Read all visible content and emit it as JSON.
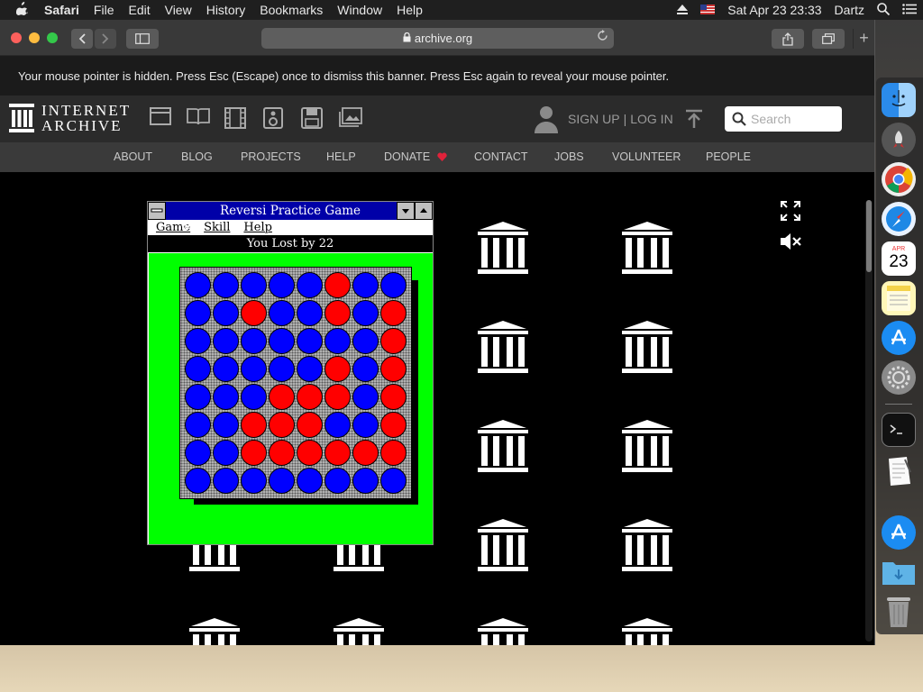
{
  "menubar": {
    "apple": "",
    "app_name": "Safari",
    "items": [
      "File",
      "Edit",
      "View",
      "History",
      "Bookmarks",
      "Window",
      "Help"
    ],
    "clock": "Sat Apr 23  23:33",
    "user": "Dartz"
  },
  "browser": {
    "url": "archive.org",
    "banner": "Your mouse pointer is hidden. Press Esc (Escape) once to dismiss this banner. Press Esc again to reveal your mouse pointer."
  },
  "ia": {
    "logo_line1": "INTERNET",
    "logo_line2": "ARCHIVE",
    "sign_up": "SIGN UP",
    "separator": "|",
    "log_in": "LOG IN",
    "search_placeholder": "Search",
    "nav": [
      "ABOUT",
      "BLOG",
      "PROJECTS",
      "HELP",
      "DONATE",
      "CONTACT",
      "JOBS",
      "VOLUNTEER",
      "PEOPLE"
    ],
    "donate_heart_color": "#e0223a",
    "media_icons": [
      "web-icon",
      "texts-icon",
      "video-icon",
      "audio-icon",
      "software-icon",
      "images-icon"
    ]
  },
  "game": {
    "title": "Reversi Practice Game",
    "menu": [
      "Game",
      "Skill",
      "Help"
    ],
    "status": "You Lost by 22",
    "colors": {
      "blue": "#0000ff",
      "red": "#ff0000",
      "felt": "#00ff00",
      "titlebar": "#0000a8"
    },
    "board": [
      "BBBBBRBB",
      "BBRBBRBR",
      "BBBBBBBR",
      "BBBBBRBR",
      "BBBRRRBR",
      "BBRRRBBR",
      "BBRRRRRR",
      "BBBBBBBB"
    ]
  },
  "dock": {
    "apps": [
      "finder-icon",
      "launchpad-icon",
      "chrome-icon",
      "safari-icon",
      "calendar-icon",
      "notes-icon",
      "app-store-icon",
      "system-preferences-icon",
      "terminal-icon",
      "textedit-icon",
      "app-store-icon",
      "downloads-folder-icon",
      "trash-icon"
    ],
    "calendar_month": "APR",
    "calendar_day": "23"
  }
}
